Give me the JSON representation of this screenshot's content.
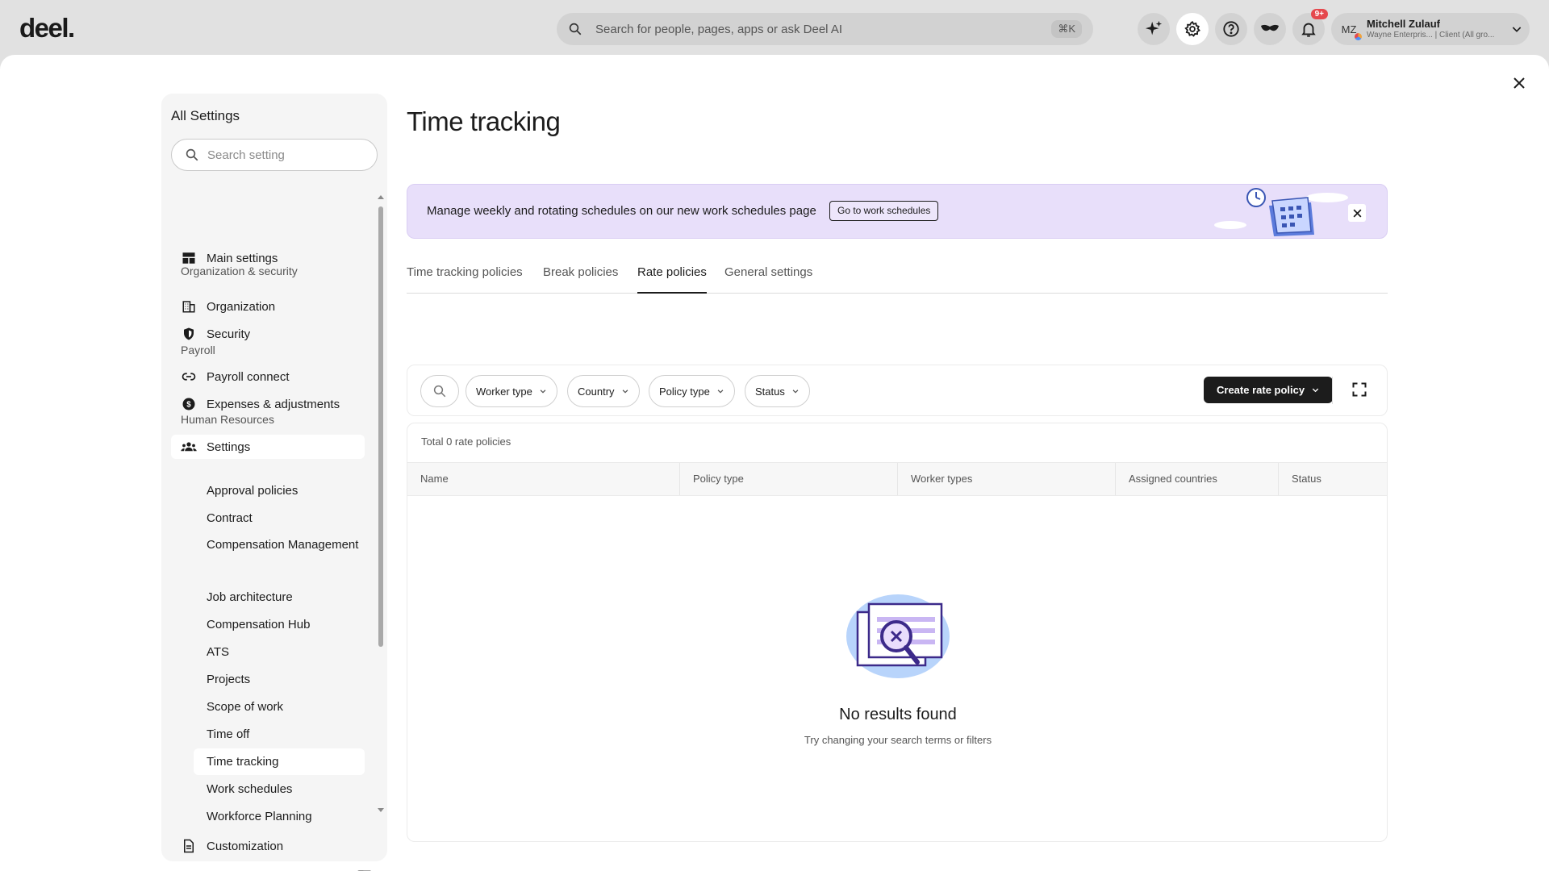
{
  "topbar": {
    "logo": "deel.",
    "search_placeholder": "Search for people, pages, apps or ask Deel AI",
    "search_shortcut": "⌘K",
    "notification_count": "9+",
    "user": {
      "initials": "MZ",
      "name": "Mitchell Zulauf",
      "org": "Wayne Enterpris... | Client (All gro..."
    }
  },
  "sidebar": {
    "title": "All Settings",
    "search_placeholder": "Search setting",
    "main_settings": "Main settings",
    "sections": {
      "org_security": "Organization & security",
      "payroll": "Payroll",
      "hr": "Human Resources"
    },
    "items": {
      "organization": "Organization",
      "security": "Security",
      "payroll_connect": "Payroll connect",
      "expenses": "Expenses & adjustments",
      "settings": "Settings",
      "customization": "Customization"
    },
    "hr_items": [
      "Approval policies",
      "Contract",
      "Compensation Management",
      "Job architecture",
      "Compensation Hub",
      "ATS",
      "Projects",
      "Scope of work",
      "Time off",
      "Time tracking",
      "Work schedules",
      "Workforce Planning"
    ]
  },
  "main": {
    "title": "Time tracking",
    "banner": {
      "text": "Manage weekly and rotating schedules on our new work schedules page",
      "button": "Go to work schedules"
    },
    "tabs": [
      "Time tracking policies",
      "Break policies",
      "Rate policies",
      "General settings"
    ],
    "active_tab": "Rate policies",
    "filters": [
      "Worker type",
      "Country",
      "Policy type",
      "Status"
    ],
    "create_button": "Create rate policy",
    "total": "Total 0 rate policies",
    "columns": [
      "Name",
      "Policy type",
      "Worker types",
      "Assigned countries",
      "Status"
    ],
    "empty": {
      "title": "No results found",
      "subtitle": "Try changing your search terms or filters"
    }
  }
}
